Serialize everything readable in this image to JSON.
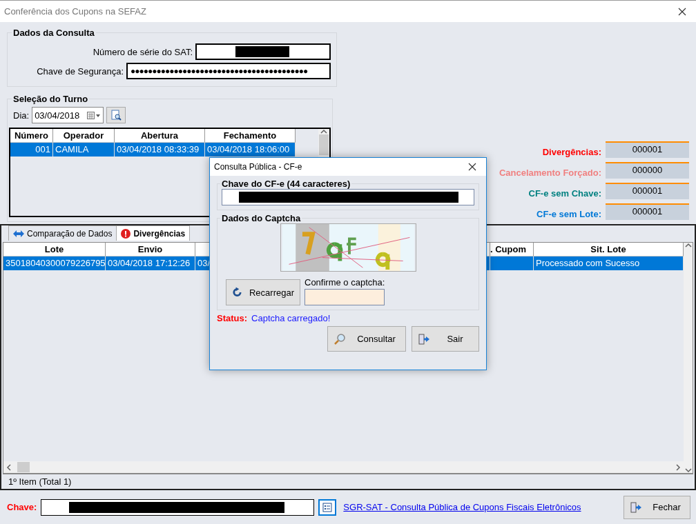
{
  "window": {
    "title": "Conferência dos Cupons na SEFAZ"
  },
  "consulta": {
    "title": "Dados da Consulta",
    "fields": [
      {
        "label": "Número de série do SAT:",
        "kind": "redacted"
      },
      {
        "label": "Chave de Segurança:",
        "kind": "password",
        "value": "●●●●●●●●●●●●●●●●●●●●●●●●●●●●●●●●●●●●●●●●●"
      }
    ]
  },
  "turno": {
    "title": "Seleção do Turno",
    "day_label": "Dia:",
    "date": "03/04/2018",
    "columns": [
      "Número",
      "Operador",
      "Abertura",
      "Fechamento"
    ],
    "rows": [
      {
        "cells": [
          "001",
          "CAMILA",
          "03/04/2018 08:33:39",
          "03/04/2018 18:06:00"
        ],
        "selected": true
      }
    ]
  },
  "counters": [
    {
      "label": "Divergências:",
      "value": "000001",
      "color": "#ff0000"
    },
    {
      "label": "Cancelamento Forçado:",
      "value": "000000",
      "color": "#f08080"
    },
    {
      "label": "CF-e sem Chave:",
      "value": "000001",
      "color": "#008080"
    },
    {
      "label": "CF-e sem Lote:",
      "value": "000001",
      "color": "#0078d7"
    }
  ],
  "tabs": [
    {
      "label": "Comparação de Dados",
      "kind": "compare",
      "selected": false
    },
    {
      "label": "Divergências",
      "kind": "alert",
      "selected": true
    }
  ],
  "grid": {
    "columns": [
      {
        "label": "Lote"
      },
      {
        "label": "Envio"
      },
      {},
      {
        "label": ". Cupom"
      },
      {
        "label": "Sit. Lote"
      }
    ],
    "rows": [
      {
        "selected": true,
        "cells": [
          {
            "text": "35018040300079226795"
          },
          {
            "text": "03/04/2018 17:12:26"
          },
          {
            "text": "03/"
          },
          {},
          {
            "text": "Processado com Sucesso"
          }
        ]
      }
    ]
  },
  "status_bar": "1º Item (Total 1)",
  "footer": {
    "label": "Chave:",
    "link": "SGR-SAT - Consulta Pública de Cupons Fiscais Eletrônicos",
    "button": "Fechar"
  },
  "dialog": {
    "title": "Consulta Pública - CF-e",
    "chave_title": "Chave do CF-e (44 caracteres)",
    "captcha_title": "Dados do Captcha",
    "reload": "Recarregar",
    "confirm_label": "Confirme o captcha:",
    "status_label": "Status:",
    "status_text": "Captcha carregado!",
    "buttons": [
      {
        "label": "Consultar",
        "kind": "search"
      },
      {
        "label": "Sair",
        "kind": "exit"
      }
    ]
  }
}
